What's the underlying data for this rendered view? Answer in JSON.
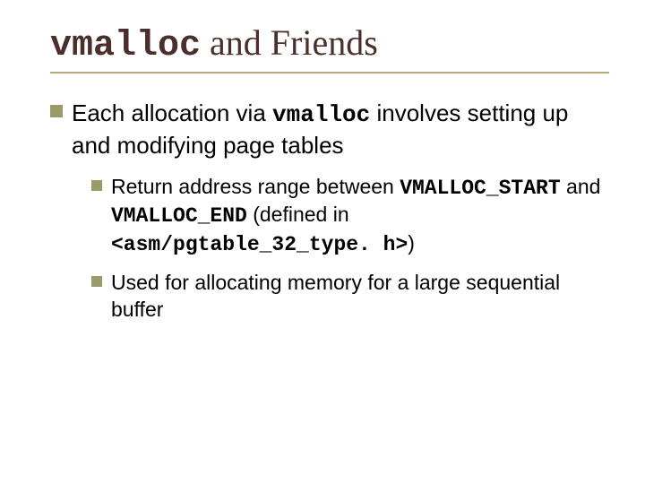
{
  "title": {
    "code": "vmalloc",
    "rest": " and Friends"
  },
  "bullets": {
    "item1": {
      "pre": "Each allocation via ",
      "code": "vmalloc",
      "post": " involves setting up and modifying page tables"
    },
    "sub1": {
      "pre": "Return address range between ",
      "c1": "VMALLOC_START",
      "mid1": " and ",
      "c2": "VMALLOC_END",
      "mid2": " (defined in ",
      "c3": "<asm/pgtable_32_type. h>",
      "post": ")"
    },
    "sub2": {
      "text": "Used for allocating memory for a large sequential buffer"
    }
  }
}
